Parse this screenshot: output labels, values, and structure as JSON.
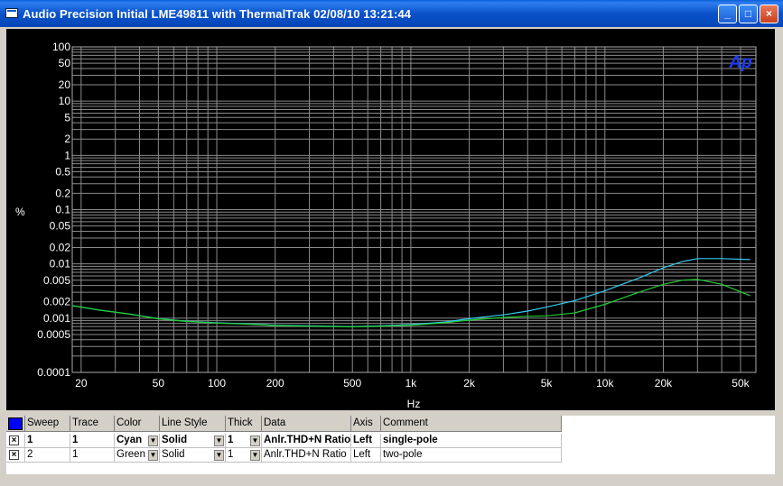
{
  "window": {
    "title": "Audio Precision  Initial LME49811 with ThermalTrak  02/08/10 13:21:44",
    "buttons": {
      "minimize": "_",
      "maximize": "□",
      "close": "×"
    }
  },
  "chart_data": {
    "type": "line",
    "x_scale": "log",
    "y_scale": "log",
    "xlabel": "Hz",
    "ylabel": "%",
    "xlim": [
      18,
      60000
    ],
    "ylim": [
      0.0001,
      100
    ],
    "grid": true,
    "logo": "Ap",
    "x_ticks": [
      {
        "v": 20,
        "label": "20"
      },
      {
        "v": 50,
        "label": "50"
      },
      {
        "v": 100,
        "label": "100"
      },
      {
        "v": 200,
        "label": "200"
      },
      {
        "v": 500,
        "label": "500"
      },
      {
        "v": 1000,
        "label": "1k"
      },
      {
        "v": 2000,
        "label": "2k"
      },
      {
        "v": 5000,
        "label": "5k"
      },
      {
        "v": 10000,
        "label": "10k"
      },
      {
        "v": 20000,
        "label": "20k"
      },
      {
        "v": 50000,
        "label": "50k"
      }
    ],
    "y_ticks": [
      {
        "v": 100,
        "label": "100"
      },
      {
        "v": 50,
        "label": "50"
      },
      {
        "v": 20,
        "label": "20"
      },
      {
        "v": 10,
        "label": "10"
      },
      {
        "v": 5,
        "label": "5"
      },
      {
        "v": 2,
        "label": "2"
      },
      {
        "v": 1,
        "label": "1"
      },
      {
        "v": 0.5,
        "label": "0.5"
      },
      {
        "v": 0.2,
        "label": "0.2"
      },
      {
        "v": 0.1,
        "label": "0.1"
      },
      {
        "v": 0.05,
        "label": "0.05"
      },
      {
        "v": 0.02,
        "label": "0.02"
      },
      {
        "v": 0.01,
        "label": "0.01"
      },
      {
        "v": 0.005,
        "label": "0.005"
      },
      {
        "v": 0.002,
        "label": "0.002"
      },
      {
        "v": 0.001,
        "label": "0.001"
      },
      {
        "v": 0.0005,
        "label": "0.0005"
      },
      {
        "v": 0.0001,
        "label": "0.0001"
      }
    ],
    "series": [
      {
        "name": "single-pole",
        "color": "#33ccee",
        "points": [
          [
            18,
            0.0017
          ],
          [
            25,
            0.0014
          ],
          [
            35,
            0.0012
          ],
          [
            50,
            0.00098
          ],
          [
            70,
            0.00088
          ],
          [
            100,
            0.00082
          ],
          [
            150,
            0.00078
          ],
          [
            200,
            0.00074
          ],
          [
            300,
            0.00072
          ],
          [
            500,
            0.0007
          ],
          [
            700,
            0.00072
          ],
          [
            1000,
            0.00076
          ],
          [
            1500,
            0.00085
          ],
          [
            2000,
            0.00098
          ],
          [
            3000,
            0.00115
          ],
          [
            4000,
            0.00135
          ],
          [
            5000,
            0.0016
          ],
          [
            7000,
            0.0021
          ],
          [
            10000,
            0.0032
          ],
          [
            15000,
            0.0055
          ],
          [
            20000,
            0.0085
          ],
          [
            25000,
            0.011
          ],
          [
            30000,
            0.0125
          ],
          [
            40000,
            0.0125
          ],
          [
            56000,
            0.012
          ]
        ]
      },
      {
        "name": "two-pole",
        "color": "#22cc33",
        "points": [
          [
            18,
            0.0017
          ],
          [
            25,
            0.0014
          ],
          [
            35,
            0.0012
          ],
          [
            50,
            0.00097
          ],
          [
            70,
            0.00087
          ],
          [
            100,
            0.00081
          ],
          [
            150,
            0.00077
          ],
          [
            200,
            0.00073
          ],
          [
            300,
            0.00071
          ],
          [
            500,
            0.00069
          ],
          [
            700,
            0.00071
          ],
          [
            1000,
            0.00074
          ],
          [
            1500,
            0.00082
          ],
          [
            2000,
            0.00092
          ],
          [
            3000,
            0.00103
          ],
          [
            4000,
            0.00108
          ],
          [
            5000,
            0.0011
          ],
          [
            7000,
            0.00125
          ],
          [
            10000,
            0.0018
          ],
          [
            15000,
            0.003
          ],
          [
            20000,
            0.0042
          ],
          [
            25000,
            0.005
          ],
          [
            30000,
            0.0052
          ],
          [
            40000,
            0.0042
          ],
          [
            56000,
            0.0026
          ]
        ]
      }
    ]
  },
  "legend": {
    "headers": [
      "Sweep",
      "Trace",
      "Color",
      "Line Style",
      "Thick",
      "Data",
      "Axis",
      "Comment"
    ],
    "rows": [
      {
        "checked": "×",
        "sweep": "1",
        "trace": "1",
        "color": "Cyan",
        "line_style": "Solid",
        "thick": "1",
        "data": "Anlr.THD+N Ratio",
        "axis": "Left",
        "comment": "single-pole"
      },
      {
        "checked": "×",
        "sweep": "2",
        "trace": "1",
        "color": "Green",
        "line_style": "Solid",
        "thick": "1",
        "data": "Anlr.THD+N Ratio",
        "axis": "Left",
        "comment": "two-pole"
      }
    ]
  }
}
